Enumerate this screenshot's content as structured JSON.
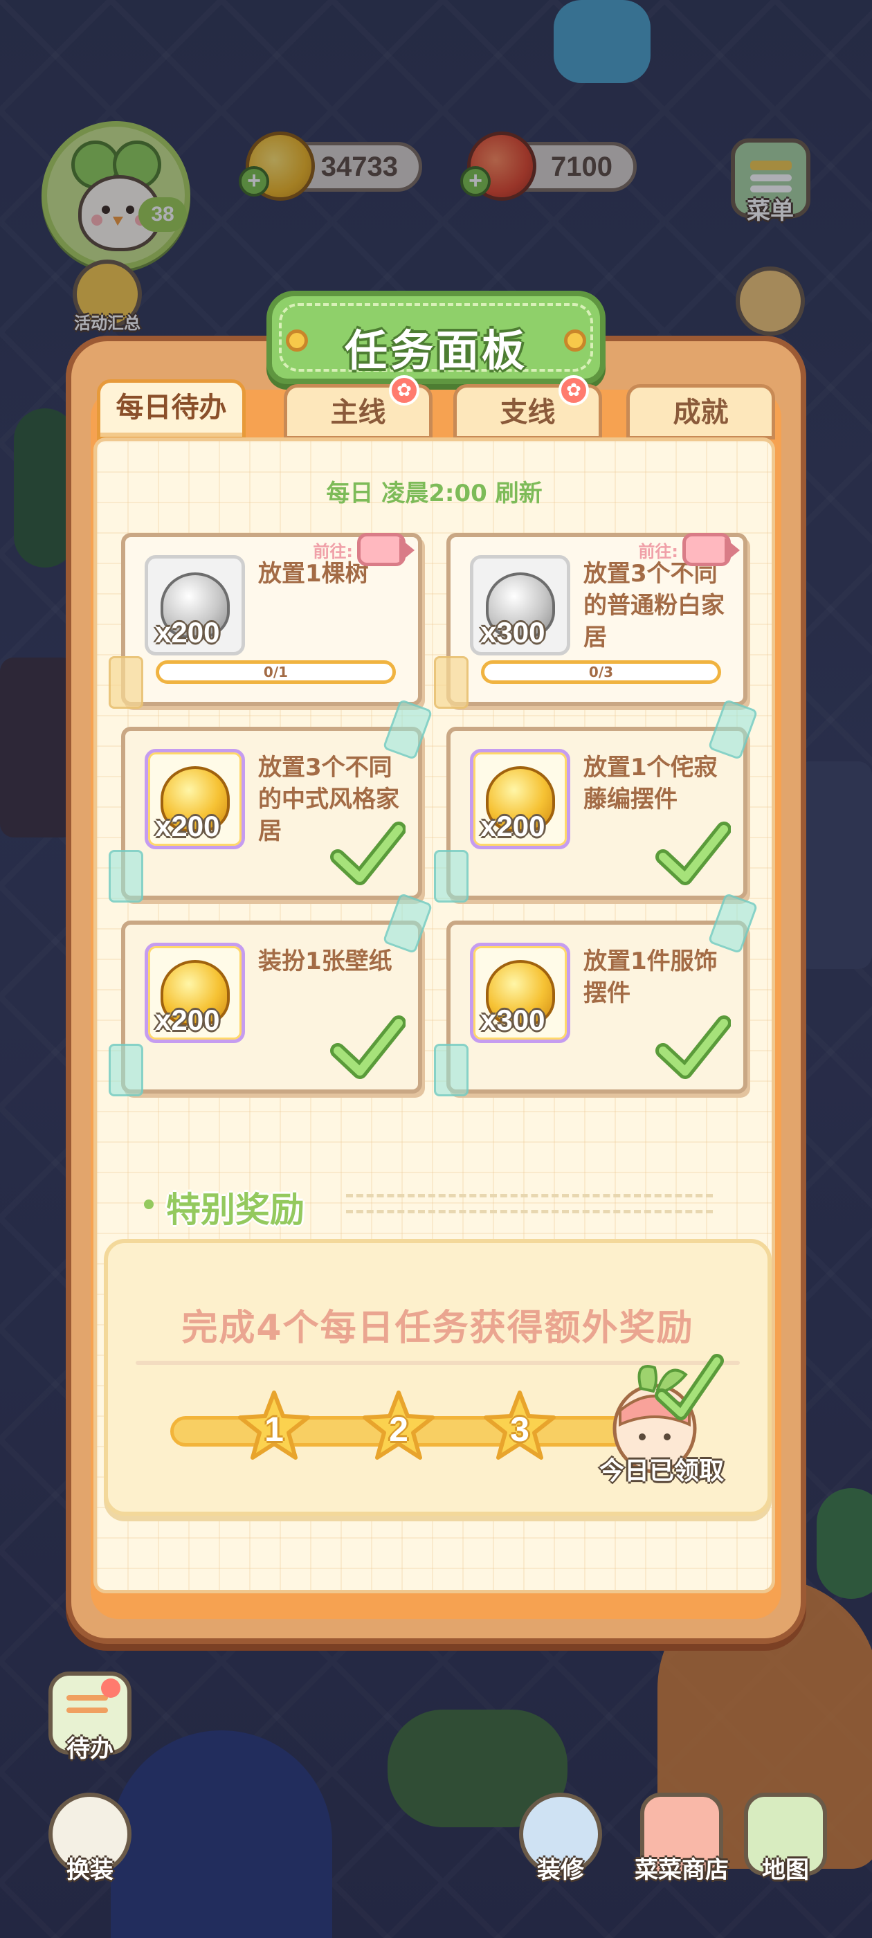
{
  "hud": {
    "level": "38",
    "coins": "34733",
    "vegetables": "7100",
    "menu_label": "菜单",
    "events_label": "活动汇总"
  },
  "panel": {
    "title": "任务面板",
    "tabs": [
      {
        "label": "每日待办",
        "active": true,
        "badge": false
      },
      {
        "label": "主线",
        "active": false,
        "badge": true
      },
      {
        "label": "支线",
        "active": false,
        "badge": true
      },
      {
        "label": "成就",
        "active": false,
        "badge": false
      }
    ],
    "refresh_note": "每日 凌晨2:00 刷新",
    "goto_label": "前往:",
    "tasks": [
      {
        "reward_type": "silver",
        "amount": "x200",
        "description": "放置1棵树",
        "progress": "0/1",
        "completed": false
      },
      {
        "reward_type": "silver",
        "amount": "x300",
        "description": "放置3个不同的普通粉白家居",
        "progress": "0/3",
        "completed": false
      },
      {
        "reward_type": "gold",
        "amount": "x200",
        "description": "放置3个不同的中式风格家居",
        "progress": "",
        "completed": true
      },
      {
        "reward_type": "gold",
        "amount": "x200",
        "description": "放置1个侘寂藤编摆件",
        "progress": "",
        "completed": true
      },
      {
        "reward_type": "gold",
        "amount": "x200",
        "description": "装扮1张壁纸",
        "progress": "",
        "completed": true
      },
      {
        "reward_type": "gold",
        "amount": "x300",
        "description": "放置1件服饰摆件",
        "progress": "",
        "completed": true
      }
    ],
    "special": {
      "title": "特别奖励",
      "text": "完成4个每日任务获得额外奖励",
      "milestones": [
        "1",
        "2",
        "3"
      ],
      "claimed_label": "今日已领取"
    }
  },
  "bottom_nav": {
    "todo": "待办",
    "dressup": "换装",
    "decorate": "装修",
    "shop": "菜菜商店",
    "map": "地图"
  },
  "colors": {
    "panel_orange": "#f6a251",
    "title_green": "#8fd06a",
    "paper": "#fff7e2",
    "check_green": "#8fd86a"
  }
}
